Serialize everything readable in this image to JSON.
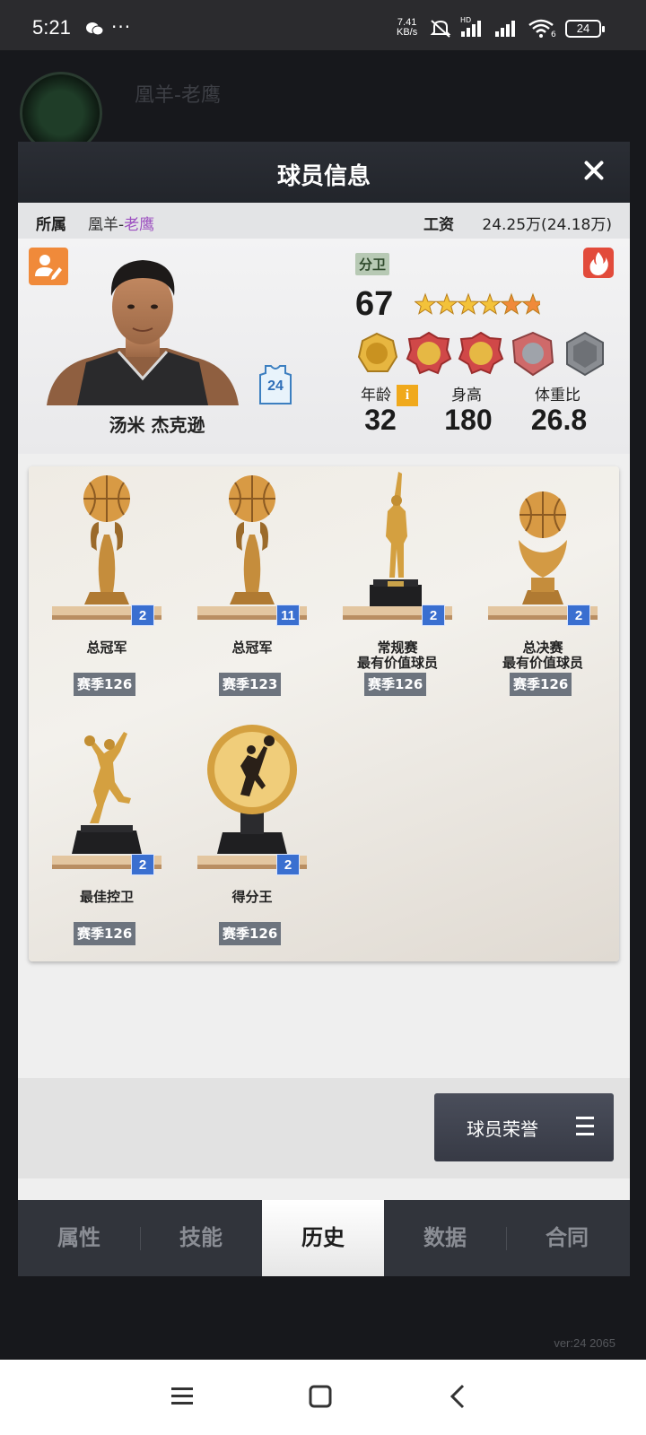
{
  "status_bar": {
    "time": "5:21",
    "dots": "···",
    "net_speed_value": "7.41",
    "net_speed_unit": "KB/s",
    "signal_label": "HD",
    "wifi_label": "6",
    "battery": "24"
  },
  "background": {
    "title": "凰羊-老鹰",
    "version": "ver:24  2065"
  },
  "modal": {
    "title": "球员信息",
    "team_label": "所属",
    "team_prefix": "凰羊-",
    "team_name": "老鹰",
    "salary_label": "工资",
    "salary_value": "24.25万(24.18万)"
  },
  "player": {
    "name": "汤米 杰克逊",
    "jersey": "24",
    "position": "分卫",
    "overall": "67",
    "star_rating": 5,
    "age_label": "年龄",
    "age_info_icon": "i",
    "age": "32",
    "height_label": "身高",
    "height": "180",
    "weight_ratio_label": "体重比",
    "weight_ratio": "26.8"
  },
  "trophies": [
    {
      "name": "总冠军",
      "name2": "",
      "count": "2",
      "season": "赛季126",
      "icon": "ball-trophy"
    },
    {
      "name": "总冠军",
      "name2": "",
      "count": "11",
      "season": "赛季123",
      "icon": "ball-trophy"
    },
    {
      "name": "常规赛",
      "name2": "最有价值球员",
      "count": "2",
      "season": "赛季126",
      "icon": "mvp-statue"
    },
    {
      "name": "总决赛",
      "name2": "最有价值球员",
      "count": "2",
      "season": "赛季126",
      "icon": "finals-trophy"
    },
    {
      "name": "最佳控卫",
      "name2": "",
      "count": "2",
      "season": "赛季126",
      "icon": "guard-statue"
    },
    {
      "name": "得分王",
      "name2": "",
      "count": "2",
      "season": "赛季126",
      "icon": "scoring-medal"
    }
  ],
  "honor_button": "球员荣誉",
  "tabs": [
    {
      "label": "属性"
    },
    {
      "label": "技能"
    },
    {
      "label": "历史"
    },
    {
      "label": "数据"
    },
    {
      "label": "合同"
    }
  ],
  "active_tab": "历史",
  "colors": {
    "accent_orange": "#f08a3a",
    "team_purple": "#9c4fc0",
    "count_blue": "#3a6fd0",
    "gold": "#d4a040"
  }
}
